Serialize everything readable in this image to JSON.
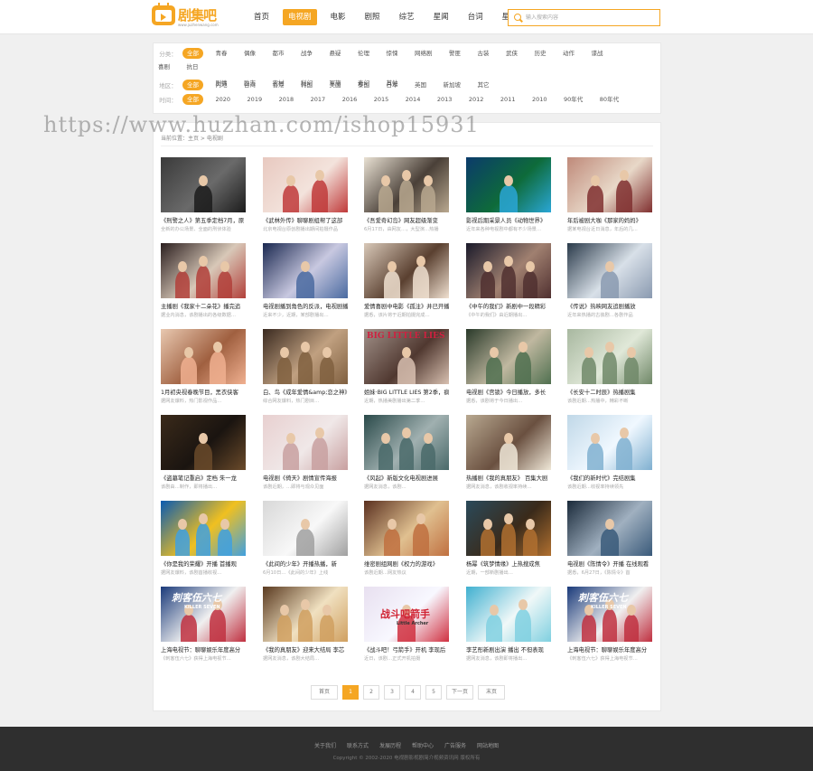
{
  "header": {
    "logo_text": "剧集吧",
    "logo_url": "www.juzhenwang.com",
    "nav": [
      {
        "label": "首页",
        "active": false
      },
      {
        "label": "电视剧",
        "active": true
      },
      {
        "label": "电影",
        "active": false
      },
      {
        "label": "剧照",
        "active": false
      },
      {
        "label": "综艺",
        "active": false
      },
      {
        "label": "星闻",
        "active": false
      },
      {
        "label": "台词",
        "active": false
      },
      {
        "label": "星库",
        "active": false
      }
    ],
    "search_placeholder": "输入搜索内容"
  },
  "filters": {
    "category": {
      "label": "分类：",
      "items": [
        "全部",
        "青春",
        "偶像",
        "都市",
        "战争",
        "悬疑",
        "伦理",
        "惊悚",
        "网络剧",
        "警匪",
        "古装",
        "武侠",
        "历史",
        "动作",
        "谍战",
        "喜剧",
        "抗日",
        "家庭",
        "剧情",
        "励志",
        "农村",
        "科幻",
        "军旅",
        "奇幻",
        "其他"
      ]
    },
    "region": {
      "label": "地区：",
      "items": [
        "全部",
        "内地",
        "台湾",
        "香港",
        "韩国",
        "美国",
        "泰国",
        "日本",
        "英国",
        "新加坡",
        "其它"
      ]
    },
    "year": {
      "label": "时间：",
      "items": [
        "全部",
        "2020",
        "2019",
        "2018",
        "2017",
        "2016",
        "2015",
        "2014",
        "2013",
        "2012",
        "2011",
        "2010",
        "90年代",
        "80年代"
      ]
    }
  },
  "breadcrumb": "当前位置：主页 > 电视剧",
  "cards": [
    {
      "title": "《刑警之人》第五季定档7月，原",
      "desc": "全新的办公场景、全面的刑侦体验",
      "colors": [
        "#3a3a3a",
        "#1c1c1c",
        "#6a6a6a"
      ]
    },
    {
      "title": "《武林外传》聊聊剧组帮了这部",
      "desc": "北京电视台原创剧播出期间拍摄作品",
      "colors": [
        "#e8c9c0",
        "#c03a3a",
        "#f3e3dc"
      ]
    },
    {
      "title": "《吾爱奇幻岛》网友超级渐变",
      "desc": "6月17日，由网友…，大型演…热播",
      "colors": [
        "#e9e1d3",
        "#b9a88f",
        "#4a4038"
      ]
    },
    {
      "title": "影视后期采景人员《动物世界》",
      "desc": "近年来各种电视剧中都有不少场景…",
      "colors": [
        "#0b3b6b",
        "#2aa6d6",
        "#0e6b3a"
      ]
    },
    {
      "title": "年后被剧大咖《那家的妈妈》",
      "desc": "据某电视台近日消息，年后的几…",
      "colors": [
        "#bf8a7a",
        "#803030",
        "#e8d8c8"
      ]
    },
    {
      "title": "主播剧《我家十二朵花》播完追",
      "desc": "据业内消息，该剧播出的各级数据…",
      "colors": [
        "#2b1f1f",
        "#b2403a",
        "#d8c8b8"
      ]
    },
    {
      "title": "电视剧播到角色的反派，电视剧播放",
      "desc": "近来不少，近期，某部剧播出…",
      "colors": [
        "#1a2850",
        "#4a6aa0",
        "#c8c8e0"
      ]
    },
    {
      "title": "爱情喜剧中电影《孤注》并已开播",
      "desc": "据悉，该片将于近期拍摄完成…",
      "colors": [
        "#d8c8b8",
        "#f0e0d0",
        "#5a4030"
      ]
    },
    {
      "title": "《中午的我们》新剧中一段精彩",
      "desc": "《中午的我们》由近期播出…",
      "colors": [
        "#1a1a2a",
        "#503030",
        "#a08070"
      ]
    },
    {
      "title": "《传说》热映网友追剧播放",
      "desc": "近年来热播的古装剧…各剧作品",
      "colors": [
        "#2a3a4a",
        "#8a9ab0",
        "#d8e0e8"
      ]
    },
    {
      "title": "1月初央视春晚节目，黑衣侠客",
      "desc": "据网友爆料，热门影视作品…",
      "colors": [
        "#e8c8b0",
        "#f0b090",
        "#a06040"
      ]
    },
    {
      "title": "白、鸟《成年爱情&amp;恋之神》",
      "desc": "综合网友爆料，热门剧目…",
      "colors": [
        "#3a2a20",
        "#806040",
        "#c0a080"
      ]
    },
    {
      "title": "姐妹·BIG LITTLE LIES 第2季，疯",
      "desc": "近期，热播美剧播出第二季…",
      "colors": [
        "#a09088",
        "#d8c0b0",
        "#503830"
      ]
    },
    {
      "title": "电视剧《宫锁》今日播放，多长",
      "desc": "据悉，该剧将于今日播出…",
      "colors": [
        "#2a3a2a",
        "#507050",
        "#c0b8a0"
      ]
    },
    {
      "title": "《长安十二时辰》热播剧集",
      "desc": "该剧近期…热播中，精彩不断",
      "colors": [
        "#a8b8a0",
        "#708868",
        "#e0e8d8"
      ]
    },
    {
      "title": "《盗墓笔记重启》定档 朱一龙",
      "desc": "该剧由…制作，即将播出…",
      "colors": [
        "#3a2a1a",
        "#6a4a2a",
        "#1a1410"
      ]
    },
    {
      "title": "电视剧《倚天》剧情宣传海报",
      "desc": "该剧近期，…即将与观众见面",
      "colors": [
        "#e8d0d0",
        "#c8a0a0",
        "#f0e8e8"
      ]
    },
    {
      "title": "《风起》新版文化电视剧进展",
      "desc": "据网友消息，该剧…",
      "colors": [
        "#2a4a4a",
        "#4a6a6a",
        "#a0b0b0"
      ]
    },
    {
      "title": "热播剧《我的真朋友》 百集大剧",
      "desc": "据网友消息，该剧收视率持续…",
      "colors": [
        "#b8a890",
        "#f0e8d8",
        "#6a5040"
      ]
    },
    {
      "title": "《我们的新时代》完结剧集",
      "desc": "该剧近期…收视率持续领先",
      "colors": [
        "#c0d8e8",
        "#80b0d0",
        "#f0f8ff"
      ]
    },
    {
      "title": "《你是我的荣耀》开播 首播观",
      "desc": "据网友爆料，该剧首播收视…",
      "colors": [
        "#0a5ab0",
        "#40a0e0",
        "#f0c020"
      ]
    },
    {
      "title": "《此间的少年》开播热播，新",
      "desc": "6月10日…《此间的少年》上线",
      "colors": [
        "#d8d8d8",
        "#a0a0a0",
        "#f8f8f8"
      ]
    },
    {
      "title": "维密剧组网剧《权力的游戏》",
      "desc": "该剧近期…网友热议",
      "colors": [
        "#5a3020",
        "#c07040",
        "#e0c090"
      ]
    },
    {
      "title": "杨幂《筑梦情缘》上热搜成焦",
      "desc": "近期，一部新剧播出…",
      "colors": [
        "#2a4a5a",
        "#b07030",
        "#3a2a1a"
      ]
    },
    {
      "title": "电视剧《陈情令》开播 在线观看",
      "desc": "据悉，6月27日，《陈情令》首",
      "colors": [
        "#1a2a3a",
        "#3a5a7a",
        "#a0b0c0"
      ]
    },
    {
      "title": "上海电视节：聊聊娱乐年度高分",
      "desc": "《刺客伍六七》获得上海电视节…",
      "colors": [
        "#1a3a7a",
        "#c03040",
        "#f0f0f0"
      ]
    },
    {
      "title": "《我的真朋友》迎来大结局 李芯",
      "desc": "据网友消息，该剧大结局…",
      "colors": [
        "#5a3a20",
        "#d0a060",
        "#f0e0c0"
      ]
    },
    {
      "title": "《战斗吧！弓箭手》开机 李现后",
      "desc": "近日，该剧…正式开机拍摄",
      "colors": [
        "#e8e0f0",
        "#d03040",
        "#f8f8ff"
      ]
    },
    {
      "title": "李艺彤新剧出演 播出 不但表现",
      "desc": "据网友消息，该剧即将播出…",
      "colors": [
        "#40b0d0",
        "#80d0e0",
        "#f0f8f8"
      ]
    },
    {
      "title": "上海电视节：聊聊娱乐年度高分",
      "desc": "《刺客伍六七》获得上海电视节…",
      "colors": [
        "#1a3a7a",
        "#c03040",
        "#f0f0f0"
      ]
    }
  ],
  "poster_texts": {
    "big_little_lies": "BIG LITTLE LIES",
    "killer": "刺客伍六七",
    "killer_en": "KILLER SEVEN",
    "archer": "战斗吧箭手",
    "archer_en": "Little Archer"
  },
  "pagination": {
    "first": "首页",
    "pages": [
      "1",
      "2",
      "3",
      "4",
      "5"
    ],
    "active_page": "1",
    "next": "下一页",
    "last": "末页"
  },
  "footer": {
    "links": [
      "关于我们",
      "联系方式",
      "发展历程",
      "帮助中心",
      "广告服务",
      "网站地图"
    ],
    "copyright": "Copyright © 2002-2020 电视剧影视剧简介视频资讯网 版权所有"
  },
  "watermark": "https://www.huzhan.com/ishop15931",
  "colors": {
    "accent": "#f5a623",
    "footer_bg": "#2f2f2f"
  }
}
